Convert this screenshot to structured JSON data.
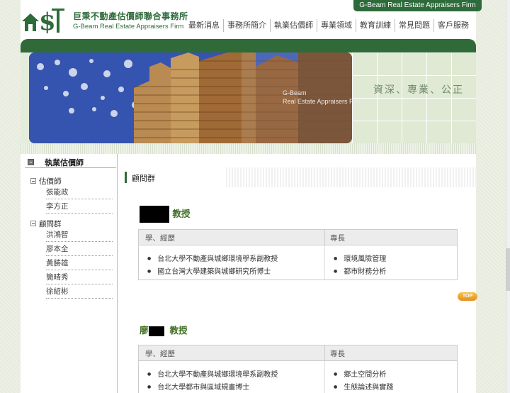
{
  "header": {
    "badge": "G-Beam Real Estate Appraisers Firm",
    "logo_cn": "巨秉不動產估價師聯合事務所",
    "logo_en": "G-Beam Real Estate Appraisers Firm"
  },
  "nav": {
    "items": [
      "最新消息",
      "事務所簡介",
      "執業估價師",
      "專業領域",
      "教育訓練",
      "常見問題",
      "客戶服務"
    ]
  },
  "banner": {
    "slogan": "資深、專業、公正",
    "title": "G-Beam",
    "subtitle": "Real Estate Appraisers Firm"
  },
  "sidebar": {
    "heading": "執業估價師",
    "groups": [
      {
        "label": "估價師",
        "items": [
          "張能政",
          "李方正"
        ]
      },
      {
        "label": "顧問群",
        "items": [
          "洪鴻智",
          "廖本全",
          "黃勝雄",
          "簡晴秀",
          "徐紹彬"
        ]
      }
    ]
  },
  "content": {
    "section_title": "顧問群",
    "people": [
      {
        "name_prefix": "",
        "title": "教授",
        "col_history": "學、經歷",
        "col_specialty": "專長",
        "history": [
          "台北大學不動產與城鄉環境學系副教授",
          "國立台灣大學建築與城鄉研究所博士"
        ],
        "specialty": [
          "環境風險管理",
          "都市財務分析"
        ]
      },
      {
        "name_prefix": "廖",
        "title": "教授",
        "col_history": "學、經歷",
        "col_specialty": "專長",
        "history": [
          "台北大學不動產與城鄉環境學系副教授",
          "台北大學都市與區域規畫博士"
        ],
        "specialty": [
          "鄉土空間分析",
          "生態論述與實踐"
        ]
      }
    ],
    "top_button": "TOP"
  }
}
